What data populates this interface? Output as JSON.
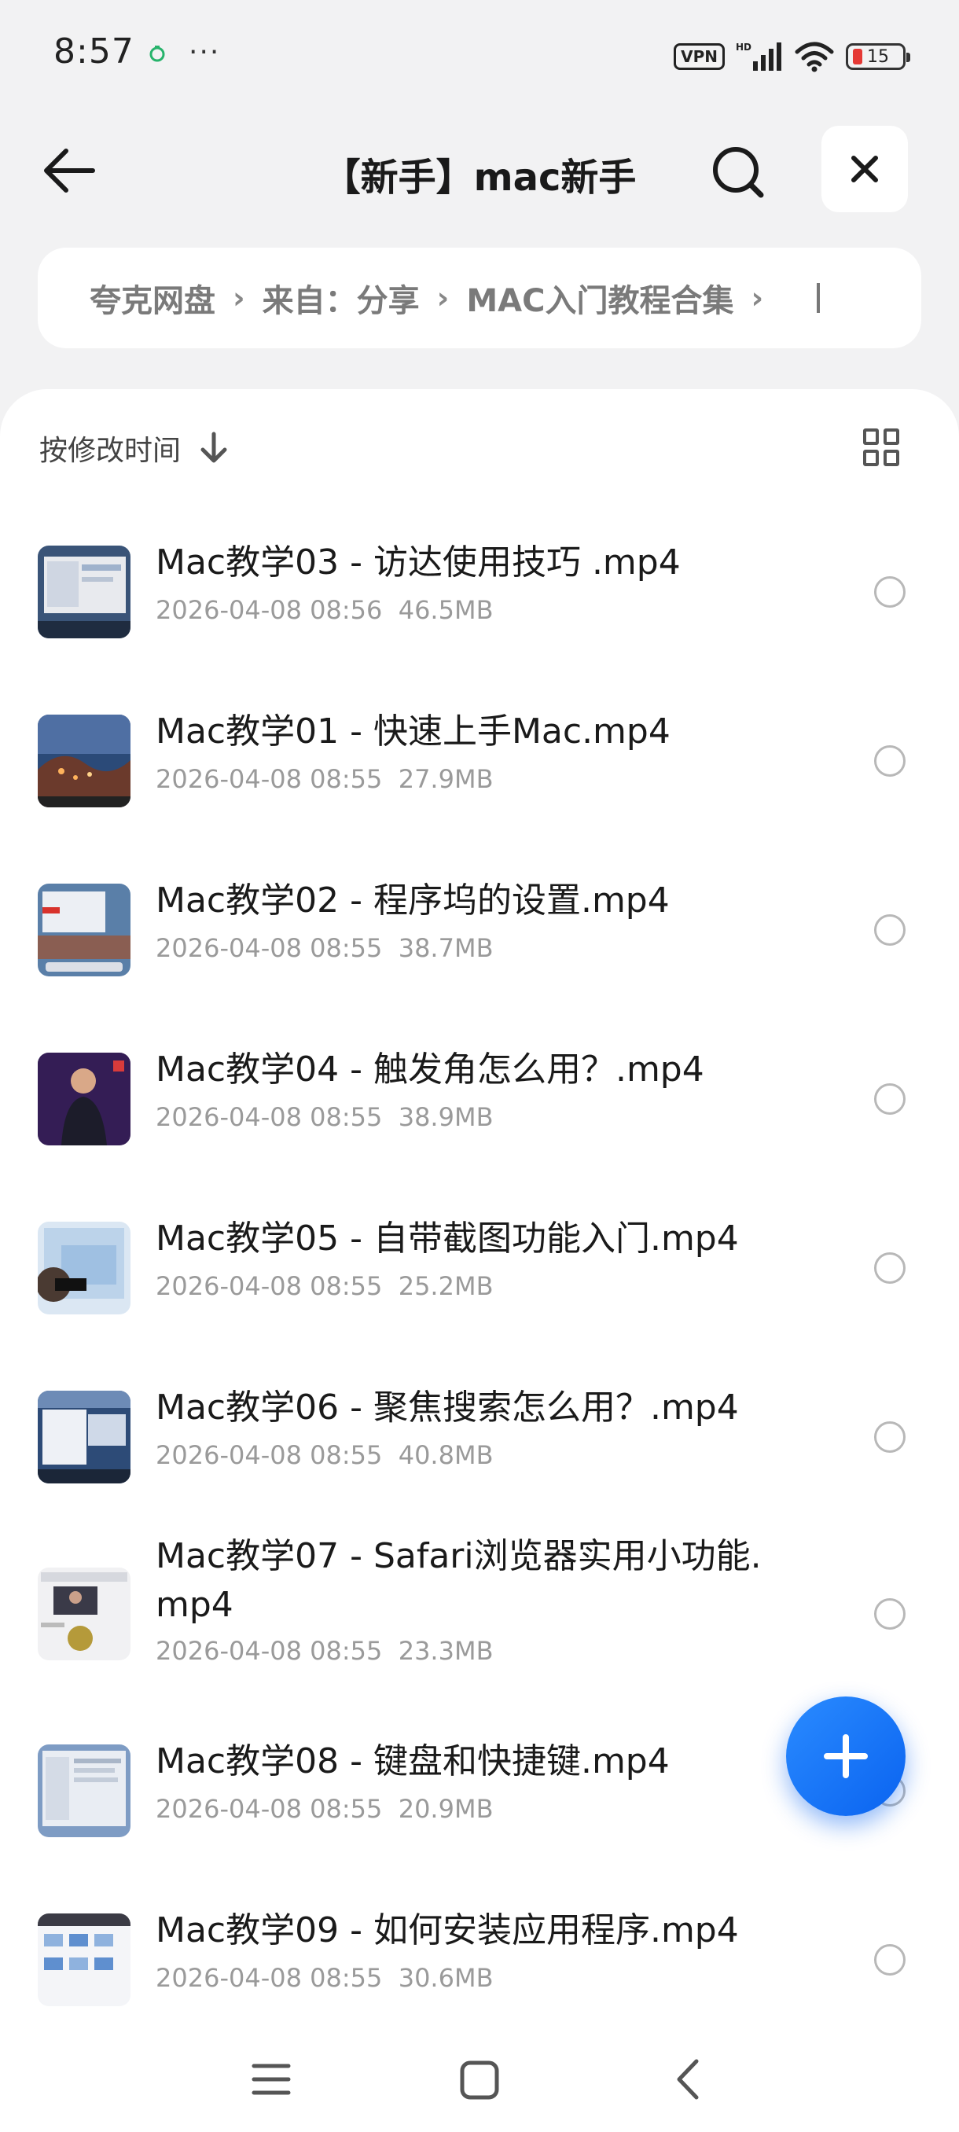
{
  "status_bar": {
    "time": "8:57",
    "more": "···",
    "vpn": "VPN",
    "battery": "15"
  },
  "header": {
    "title": "【新手】mac新手"
  },
  "breadcrumb": {
    "items": [
      "夸克网盘",
      "来自：分享",
      "MAC入门教程合集"
    ]
  },
  "toolbar": {
    "sort_label": "按修改时间"
  },
  "files": [
    {
      "name": "Mac教学03 - 访达使用技巧 .mp4",
      "date": "2026-04-08 08:56",
      "size": "46.5MB"
    },
    {
      "name": "Mac教学01 - 快速上手Mac.mp4",
      "date": "2026-04-08 08:55",
      "size": "27.9MB"
    },
    {
      "name": "Mac教学02 - 程序坞的设置.mp4",
      "date": "2026-04-08 08:55",
      "size": "38.7MB"
    },
    {
      "name": "Mac教学04 - 触发角怎么用？.mp4",
      "date": "2026-04-08 08:55",
      "size": "38.9MB"
    },
    {
      "name": "Mac教学05 - 自带截图功能入门.mp4",
      "date": "2026-04-08 08:55",
      "size": "25.2MB"
    },
    {
      "name": "Mac教学06 - 聚焦搜索怎么用？.mp4",
      "date": "2026-04-08 08:55",
      "size": "40.8MB"
    },
    {
      "name": "Mac教学07 - Safari浏览器实用小功能.mp4",
      "name_line1": "Mac教学07 - Safari浏览器实用小功能.",
      "name_line2": "mp4",
      "date": "2026-04-08 08:55",
      "size": "23.3MB"
    },
    {
      "name": "Mac教学08 - 键盘和快捷键.mp4",
      "date": "2026-04-08 08:55",
      "size": "20.9MB"
    },
    {
      "name": "Mac教学09 - 如何安装应用程序.mp4",
      "date": "2026-04-08 08:55",
      "size": "30.6MB"
    }
  ],
  "colors": {
    "accent": "#1a73f5",
    "background": "#f2f2f3",
    "meta_text": "#9a9a9a"
  },
  "icons": {
    "back": "arrow-left-icon",
    "search": "search-icon",
    "close": "close-icon",
    "sort": "arrow-down-icon",
    "grid": "grid-view-icon",
    "fab": "plus-icon",
    "nav": [
      "menu-icon",
      "home-icon",
      "back-chevron-icon"
    ]
  }
}
